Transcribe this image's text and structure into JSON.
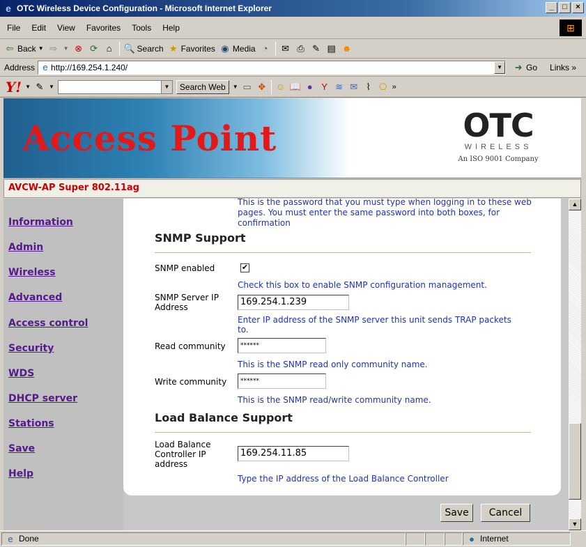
{
  "window": {
    "title": "OTC Wireless Device Configuration - Microsoft Internet Explorer",
    "min": "_",
    "max": "□",
    "close": "×"
  },
  "menu": [
    "File",
    "Edit",
    "View",
    "Favorites",
    "Tools",
    "Help"
  ],
  "toolbar": {
    "back": "Back",
    "search": "Search",
    "favorites": "Favorites",
    "media": "Media"
  },
  "address": {
    "label": "Address",
    "url": "http://169.254.1.240/",
    "go": "Go",
    "links": "Links"
  },
  "yahoo": {
    "logo": "Y!",
    "search_button": "Search Web"
  },
  "banner": {
    "title": "Access Point",
    "logo": "OTC",
    "logo_sub": "WIRELESS",
    "iso": "An ISO 9001 Company"
  },
  "product": "AVCW-AP Super 802.11ag",
  "nav": [
    "Information",
    "Admin",
    "Wireless",
    "Advanced",
    "Access control",
    "Security",
    "WDS",
    "DHCP server",
    "Stations",
    "Save",
    "Help"
  ],
  "password_help": "This is the password that you must type when logging in to these web pages. You must enter the same password into both boxes, for confirmation",
  "snmp": {
    "heading": "SNMP Support",
    "enabled_label": "SNMP enabled",
    "enabled_check": "✔",
    "enabled_help": "Check this box to enable SNMP configuration management.",
    "server_label": "SNMP Server IP Address",
    "server_value": "169.254.1.239",
    "server_help": "Enter IP address of the SNMP server this unit sends TRAP packets to.",
    "read_label": "Read community",
    "read_value": "******",
    "read_help": "This is the SNMP read only community name.",
    "write_label": "Write community",
    "write_value": "******",
    "write_help": "This is the SNMP read/write community name."
  },
  "lb": {
    "heading": "Load Balance Support",
    "label": "Load Balance Controller IP address",
    "value": "169.254.11.85",
    "help": "Type the IP address of the Load Balance Controller"
  },
  "buttons": {
    "save": "Save",
    "cancel": "Cancel"
  },
  "status": {
    "text": "Done",
    "zone": "Internet"
  }
}
